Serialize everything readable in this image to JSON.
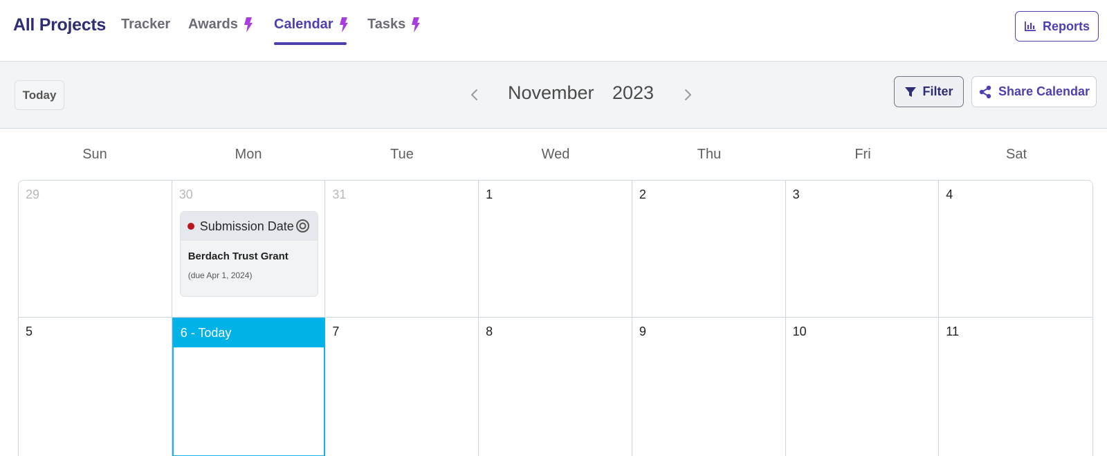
{
  "nav": {
    "brand": "All Projects",
    "tabs": [
      {
        "label": "Tracker",
        "bolt": false,
        "active": false
      },
      {
        "label": "Awards",
        "bolt": true,
        "active": false
      },
      {
        "label": "Calendar",
        "bolt": true,
        "active": true
      },
      {
        "label": "Tasks",
        "bolt": true,
        "active": false
      }
    ],
    "reports_label": "Reports"
  },
  "toolbar": {
    "today_label": "Today",
    "month": "November",
    "year": "2023",
    "filter_label": "Filter",
    "share_label": "Share Calendar"
  },
  "calendar": {
    "weekdays": [
      "Sun",
      "Mon",
      "Tue",
      "Wed",
      "Thu",
      "Fri",
      "Sat"
    ],
    "days": [
      {
        "label": "29",
        "muted": true
      },
      {
        "label": "30",
        "muted": true
      },
      {
        "label": "31",
        "muted": true
      },
      {
        "label": "1",
        "muted": false
      },
      {
        "label": "2",
        "muted": false
      },
      {
        "label": "3",
        "muted": false
      },
      {
        "label": "4",
        "muted": false
      },
      {
        "label": "5",
        "muted": false
      },
      {
        "label": "6 - Today",
        "muted": false,
        "today": true
      },
      {
        "label": "7",
        "muted": false
      },
      {
        "label": "8",
        "muted": false
      },
      {
        "label": "9",
        "muted": false
      },
      {
        "label": "10",
        "muted": false
      },
      {
        "label": "11",
        "muted": false
      }
    ],
    "event": {
      "type": "Submission Date",
      "title": "Berdach Trust Grant",
      "due": "(due Apr 1, 2024)",
      "dot_color": "#bb1620"
    }
  },
  "colors": {
    "brand": "#2f2e74",
    "accent": "#4b3fb2",
    "today": "#00b2e8",
    "bolt": "#a83ce0"
  }
}
